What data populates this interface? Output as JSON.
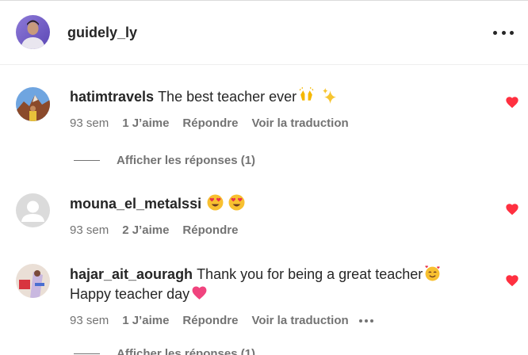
{
  "post": {
    "username": "guidely_ly",
    "more_icon": "more-horizontal-icon"
  },
  "comments": [
    {
      "author": "hatimtravels",
      "text": "The best teacher ever",
      "emojis": [
        "raising-hands",
        "sparkles"
      ],
      "age": "93 sem",
      "likes": "1 J’aime",
      "reply": "Répondre",
      "translate": "Voir la traduction",
      "liked": true,
      "view_replies": "Afficher les réponses (1)"
    },
    {
      "author": "mouna_el_metalssi",
      "text": "",
      "emojis": [
        "heart-eyes",
        "heart-eyes"
      ],
      "age": "93 sem",
      "likes": "2 J’aime",
      "reply": "Répondre",
      "liked": true
    },
    {
      "author": "hajar_ait_aouragh",
      "text": "Thank you for being a great teacher",
      "line2": "Happy teacher day",
      "emojis": [
        "smiling-face-with-hearts",
        "pink-heart"
      ],
      "age": "93 sem",
      "likes": "1 J’aime",
      "reply": "Répondre",
      "translate": "Voir la traduction",
      "liked": true,
      "view_replies": "Afficher les réponses (1)"
    }
  ],
  "colors": {
    "text": "#262626",
    "secondary": "#737373",
    "like_red": "#ff3040",
    "divider": "#efefef"
  }
}
